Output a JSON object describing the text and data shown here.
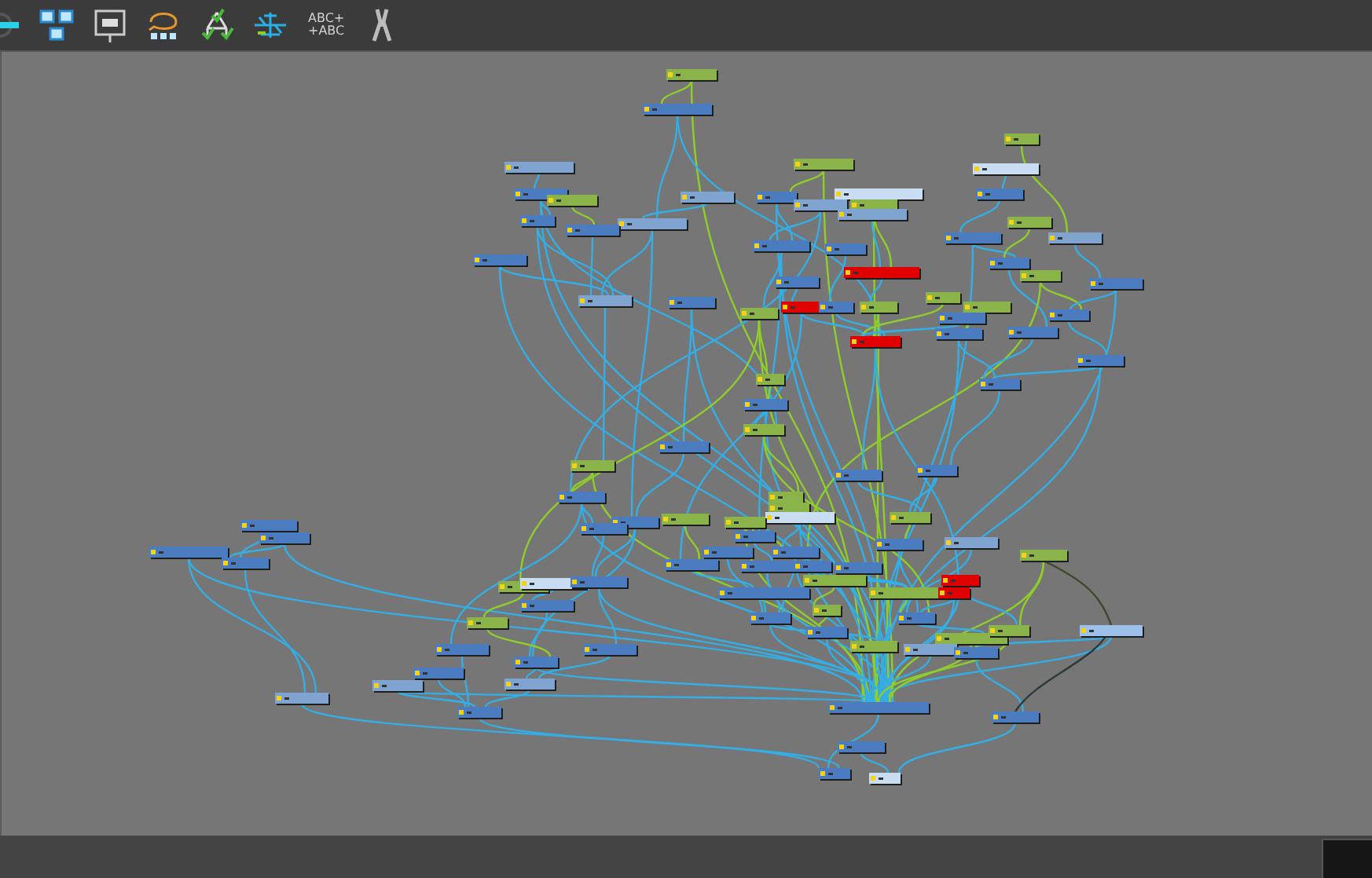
{
  "toolbar": {
    "text_icon_lines": [
      "ABC+",
      "+ABC"
    ]
  },
  "nodes": [
    {
      "color": "#8ab34a"
    },
    {
      "color": "#4a7cbf"
    },
    {
      "color": "#7fa4cf"
    },
    {
      "color": "#8ab34a"
    },
    {
      "color": "#c9def2"
    },
    {
      "color": "#8ab34a"
    },
    {
      "color": "#4a7cbf"
    },
    {
      "color": "#8ab34a"
    },
    {
      "color": "#7fa4cf"
    },
    {
      "color": "#4a7cbf"
    },
    {
      "color": "#c9def2"
    },
    {
      "color": "#7fa4cf"
    },
    {
      "color": "#8ab34a"
    },
    {
      "color": "#7fa4cf"
    },
    {
      "color": "#4a7cbf"
    },
    {
      "color": "#4a7cbf"
    },
    {
      "color": "#7fa4cf"
    },
    {
      "color": "#4a7cbf"
    },
    {
      "color": "#4a7cbf"
    },
    {
      "color": "#8ab34a"
    },
    {
      "color": "#7fa4cf"
    },
    {
      "color": "#4a7cbf"
    },
    {
      "color": "#4a7cbf"
    },
    {
      "color": "#4a7cbf"
    },
    {
      "color": "#4a7cbf"
    },
    {
      "color": "#e00000"
    },
    {
      "color": "#8ab34a"
    },
    {
      "color": "#4a7cbf"
    },
    {
      "color": "#4a7cbf"
    },
    {
      "color": "#7fa4cf"
    },
    {
      "color": "#4a7cbf"
    },
    {
      "color": "#e00000"
    },
    {
      "color": "#4a7cbf"
    },
    {
      "color": "#8ab34a"
    },
    {
      "color": "#8ab34a"
    },
    {
      "color": "#8ab34a"
    },
    {
      "color": "#8ab34a"
    },
    {
      "color": "#4a7cbf"
    },
    {
      "color": "#4a7cbf"
    },
    {
      "color": "#4a7cbf"
    },
    {
      "color": "#4a7cbf"
    },
    {
      "color": "#e00000"
    },
    {
      "color": "#4a7cbf"
    },
    {
      "color": "#4a7cbf"
    },
    {
      "color": "#8ab34a"
    },
    {
      "color": "#4a7cbf"
    },
    {
      "color": "#8ab34a"
    },
    {
      "color": "#4a7cbf"
    },
    {
      "color": "#8ab34a"
    },
    {
      "color": "#4a7cbf"
    },
    {
      "color": "#4a7cbf"
    },
    {
      "color": "#4a7cbf"
    },
    {
      "color": "#8ab34a"
    },
    {
      "color": "#8ab34a"
    },
    {
      "color": "#c9def2"
    },
    {
      "color": "#8ab34a"
    },
    {
      "color": "#4a7cbf"
    },
    {
      "color": "#8ab34a"
    },
    {
      "color": "#8ab34a"
    },
    {
      "color": "#4a7cbf"
    },
    {
      "color": "#4a7cbf"
    },
    {
      "color": "#4a7cbf"
    },
    {
      "color": "#4a7cbf"
    },
    {
      "color": "#4a7cbf"
    },
    {
      "color": "#4a7cbf"
    },
    {
      "color": "#4a7cbf"
    },
    {
      "color": "#4a7cbf"
    },
    {
      "color": "#4a7cbf"
    },
    {
      "color": "#7fa4cf"
    },
    {
      "color": "#8ab34a"
    },
    {
      "color": "#4a7cbf"
    },
    {
      "color": "#4a7cbf"
    },
    {
      "color": "#4a7cbf"
    },
    {
      "color": "#4a7cbf"
    },
    {
      "color": "#8ab34a"
    },
    {
      "color": "#e00000"
    },
    {
      "color": "#8ab34a"
    },
    {
      "color": "#c9def2"
    },
    {
      "color": "#4a7cbf"
    },
    {
      "color": "#4a7cbf"
    },
    {
      "color": "#8ab34a"
    },
    {
      "color": "#e00000"
    },
    {
      "color": "#4a7cbf"
    },
    {
      "color": "#8ab34a"
    },
    {
      "color": "#4a7cbf"
    },
    {
      "color": "#8ab34a"
    },
    {
      "color": "#4a7cbf"
    },
    {
      "color": "#9dc0ea"
    },
    {
      "color": "#4a7cbf"
    },
    {
      "color": "#8ab34a"
    },
    {
      "color": "#8ab34a"
    },
    {
      "color": "#4a7cbf"
    },
    {
      "color": "#4a7cbf"
    },
    {
      "color": "#8ab34a"
    },
    {
      "color": "#7fa4cf"
    },
    {
      "color": "#4a7cbf"
    },
    {
      "color": "#4a7cbf"
    },
    {
      "color": "#4a7cbf"
    },
    {
      "color": "#7fa4cf"
    },
    {
      "color": "#7fa4cf"
    },
    {
      "color": "#7fa4cf"
    },
    {
      "color": "#4a7cbf"
    },
    {
      "color": "#4a7cbf"
    },
    {
      "color": "#4a7cbf"
    },
    {
      "color": "#4a7cbf"
    },
    {
      "color": "#4a7cbf"
    },
    {
      "color": "#c9def2"
    }
  ]
}
